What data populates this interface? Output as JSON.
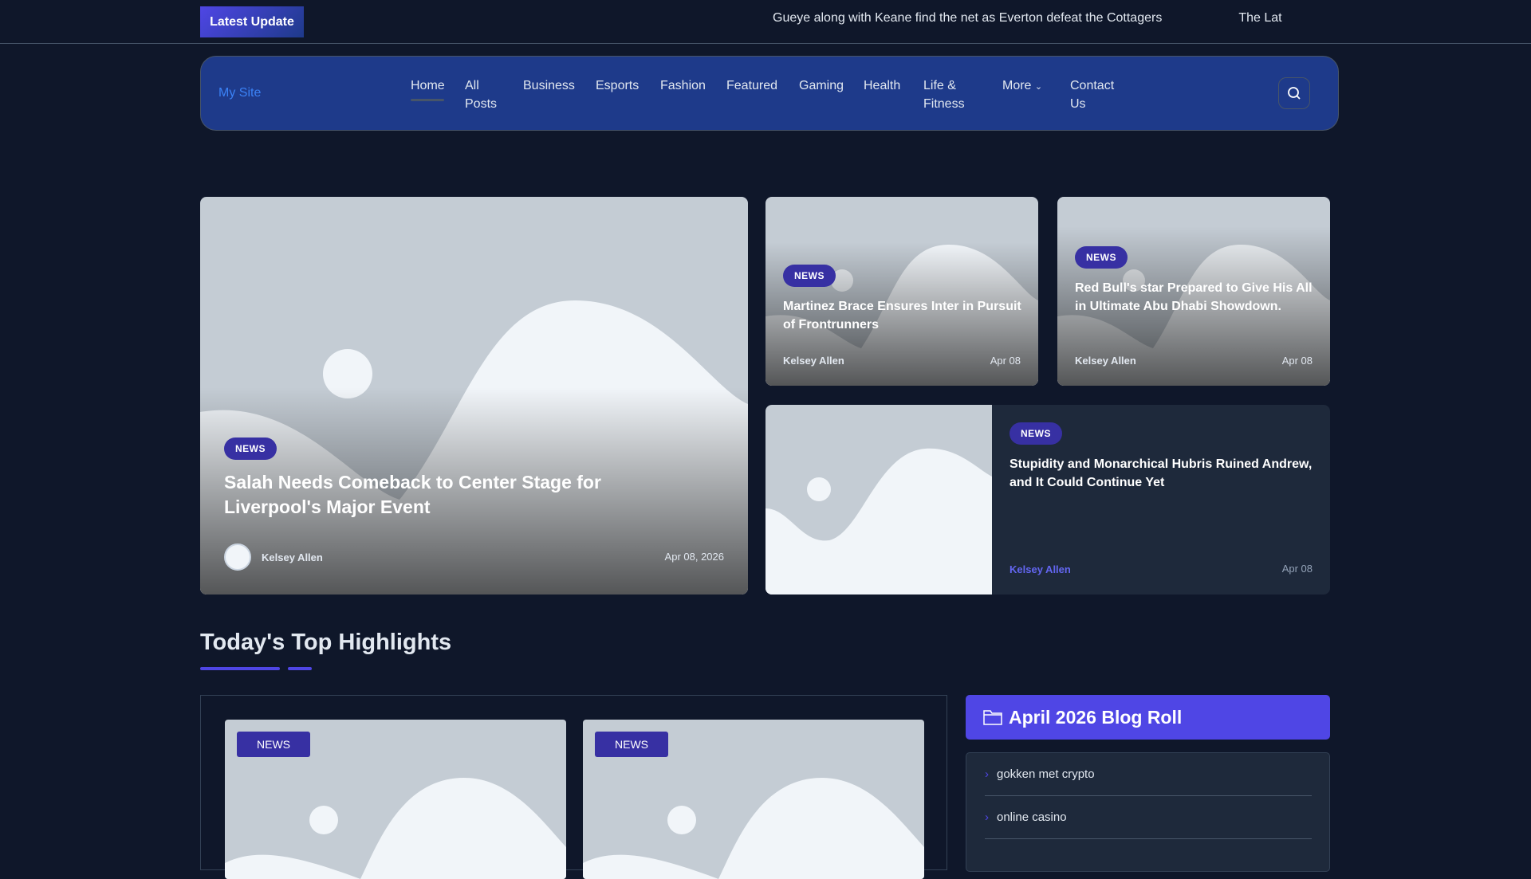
{
  "topbar": {
    "latest_label": "Latest Update",
    "ticker": [
      "Gueye along with Keane find the net as Everton defeat the Cottagers",
      "The Lat"
    ]
  },
  "nav": {
    "site": "My Site",
    "items": [
      "Home",
      "All Posts",
      "Business",
      "Esports",
      "Fashion",
      "Featured",
      "Gaming",
      "Health",
      "Life & Fitness",
      "More",
      "Contact Us"
    ]
  },
  "hero": {
    "badge": "NEWS",
    "title": "Salah Needs Comeback to Center Stage for Liverpool's Major Event",
    "author": "Kelsey Allen",
    "date": "Apr 08, 2026"
  },
  "cards": [
    {
      "badge": "NEWS",
      "title": "Martinez Brace Ensures Inter in Pursuit of Frontrunners",
      "author": "Kelsey Allen",
      "date": "Apr 08"
    },
    {
      "badge": "NEWS",
      "title": "Red Bull's star Prepared to Give His All in Ultimate Abu Dhabi Showdown.",
      "author": "Kelsey Allen",
      "date": "Apr 08"
    },
    {
      "badge": "NEWS",
      "title": "Stupidity and Monarchical Hubris Ruined Andrew, and It Could Continue Yet",
      "author": "Kelsey Allen",
      "date": "Apr 08"
    }
  ],
  "highlights": {
    "title": "Today's Top Highlights",
    "cards": [
      {
        "badge": "NEWS"
      },
      {
        "badge": "NEWS"
      }
    ]
  },
  "blogroll": {
    "title": "April 2026 Blog Roll",
    "items": [
      "gokken met crypto",
      "online casino"
    ]
  },
  "colors": {
    "bg": "#0f172a",
    "nav": "#1e3a8a",
    "accent": "#4f46e5"
  }
}
